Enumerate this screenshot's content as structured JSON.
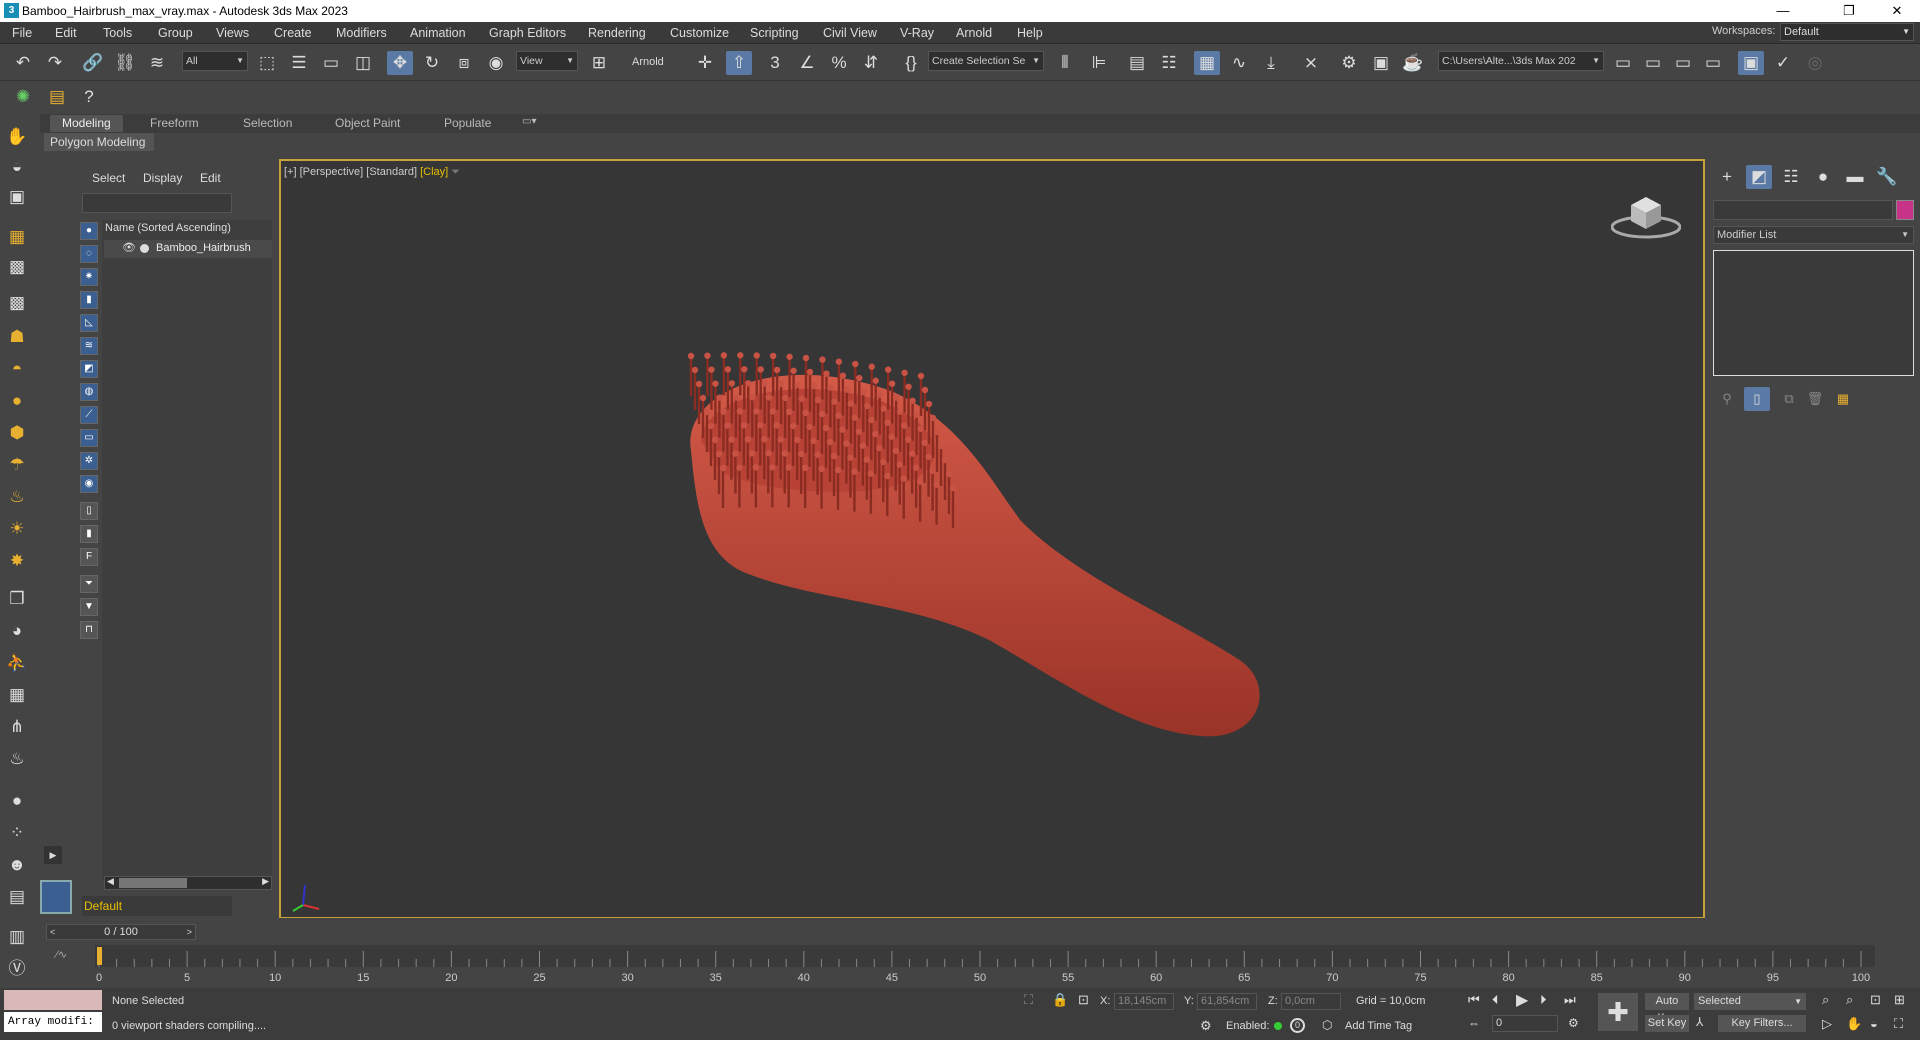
{
  "window": {
    "title": "Bamboo_Hairbrush_max_vray.max - Autodesk 3ds Max 2023"
  },
  "menu": [
    "File",
    "Edit",
    "Tools",
    "Group",
    "Views",
    "Create",
    "Modifiers",
    "Animation",
    "Graph Editors",
    "Rendering",
    "Customize",
    "Scripting",
    "Civil View",
    "V-Ray",
    "Arnold",
    "Help"
  ],
  "workspace": {
    "label": "Workspaces:",
    "value": "Default"
  },
  "toolbar": {
    "selection_filter": "All",
    "ref_coord": "View",
    "arnold_label": "Arnold",
    "named_selection": "Create Selection Se",
    "project_path": "C:\\Users\\Alte...\\3ds Max 202"
  },
  "ribbon": {
    "tabs": [
      "Modeling",
      "Freeform",
      "Selection",
      "Object Paint",
      "Populate"
    ],
    "active": "Modeling",
    "sub": "Polygon Modeling"
  },
  "scene_explorer": {
    "tabs": [
      "Select",
      "Display",
      "Edit"
    ],
    "column_header": "Name (Sorted Ascending)",
    "items": [
      "Bamboo_Hairbrush"
    ],
    "layer": "Default"
  },
  "viewport": {
    "label_plus": "[+]",
    "label_view": "[Perspective]",
    "label_shading": "[Standard]",
    "label_clay": "[Clay]"
  },
  "command_panel": {
    "modifier_list": "Modifier List"
  },
  "timeline": {
    "frame": "0 / 100",
    "ticks": [
      "0",
      "5",
      "10",
      "15",
      "20",
      "25",
      "30",
      "35",
      "40",
      "45",
      "50",
      "55",
      "60",
      "65",
      "70",
      "75",
      "80",
      "85",
      "90",
      "95",
      "100"
    ]
  },
  "status": {
    "selection": "None Selected",
    "message": "0 viewport shaders compiling....",
    "maxscript": "Array modifi:",
    "x_label": "X:",
    "x_value": "18,145cm",
    "y_label": "Y:",
    "y_value": "61,854cm",
    "z_label": "Z:",
    "z_value": "0,0cm",
    "grid": "Grid = 10,0cm",
    "enabled_label": "Enabled:",
    "add_time_tag": "Add Time Tag",
    "auto_key": "Auto Key",
    "set_key": "Set Key",
    "key_mode": "Selected",
    "key_filters": "Key Filters...",
    "frame_field": "0"
  },
  "colors": {
    "accent": "#5a7aa5",
    "viewport_border": "#c9a03a",
    "object": "#c0473c",
    "swatch": "#c8338a"
  }
}
